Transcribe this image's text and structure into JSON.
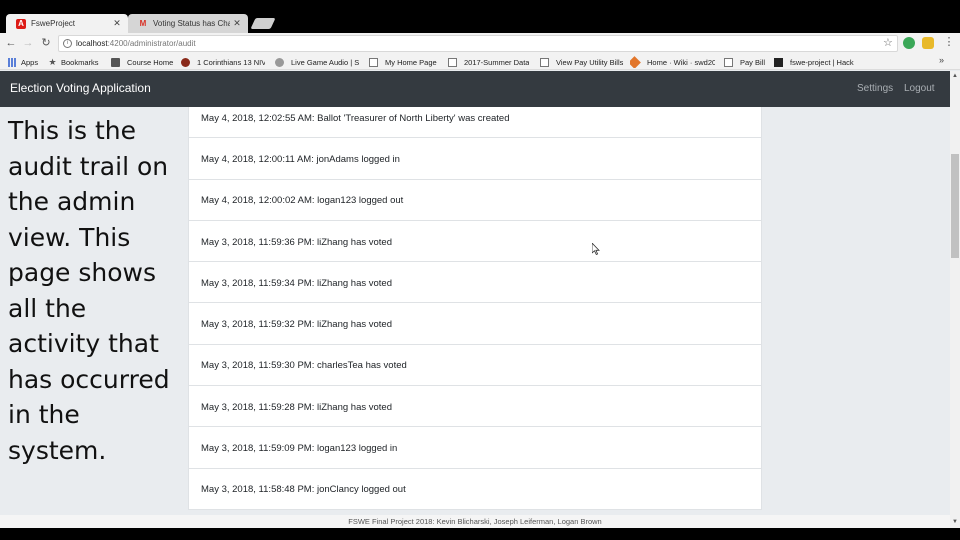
{
  "browser": {
    "tabs": [
      {
        "title": "FsweProject",
        "active": true
      },
      {
        "title": "Voting Status has Change",
        "active": false
      }
    ],
    "url": {
      "host": "localhost",
      "path": ":4200/administrator/audit"
    },
    "bookmarks": [
      {
        "label": "Apps",
        "icon": "apps-icon"
      },
      {
        "label": "Bookmarks",
        "icon": "star-icon"
      },
      {
        "label": "Course Home",
        "icon": "document-icon"
      },
      {
        "label": "1 Corinthians 13 NIV",
        "icon": "bible-icon"
      },
      {
        "label": "Live Game Audio | S",
        "icon": "game-audio-icon"
      },
      {
        "label": "My Home Page",
        "icon": "page-icon"
      },
      {
        "label": "2017-Summer Data",
        "icon": "page-icon"
      },
      {
        "label": "View Pay Utility Bills",
        "icon": "page-icon"
      },
      {
        "label": "Home · Wiki · swd20",
        "icon": "gitlab-icon"
      },
      {
        "label": "Pay Bill",
        "icon": "page-icon"
      },
      {
        "label": "fswe-project | Hack",
        "icon": "github-icon"
      }
    ]
  },
  "app": {
    "brand": "Election Voting Application",
    "nav": {
      "settings": "Settings",
      "logout": "Logout"
    }
  },
  "annotation": "This is the audit trail on the admin view. This page shows all the activity that has occurred in the system.",
  "audit_entries": [
    "May 4, 2018, 12:02:55 AM: Ballot 'Treasurer of North Liberty' was created",
    "May 4, 2018, 12:00:11 AM: jonAdams logged in",
    "May 4, 2018, 12:00:02 AM: logan123 logged out",
    "May 3, 2018, 11:59:36 PM: liZhang has voted",
    "May 3, 2018, 11:59:34 PM: liZhang has voted",
    "May 3, 2018, 11:59:32 PM: liZhang has voted",
    "May 3, 2018, 11:59:30 PM: charlesTea has voted",
    "May 3, 2018, 11:59:28 PM: liZhang has voted",
    "May 3, 2018, 11:59:09 PM: logan123 logged in",
    "May 3, 2018, 11:58:48 PM: jonClancy logged out"
  ],
  "footer": "FSWE Final Project 2018: Kevin Blicharski, Joseph Leiferman, Logan Brown",
  "colors": {
    "navbar": "#343a40",
    "page_bg": "#e9ecef",
    "entry_bg": "#ffffff"
  }
}
